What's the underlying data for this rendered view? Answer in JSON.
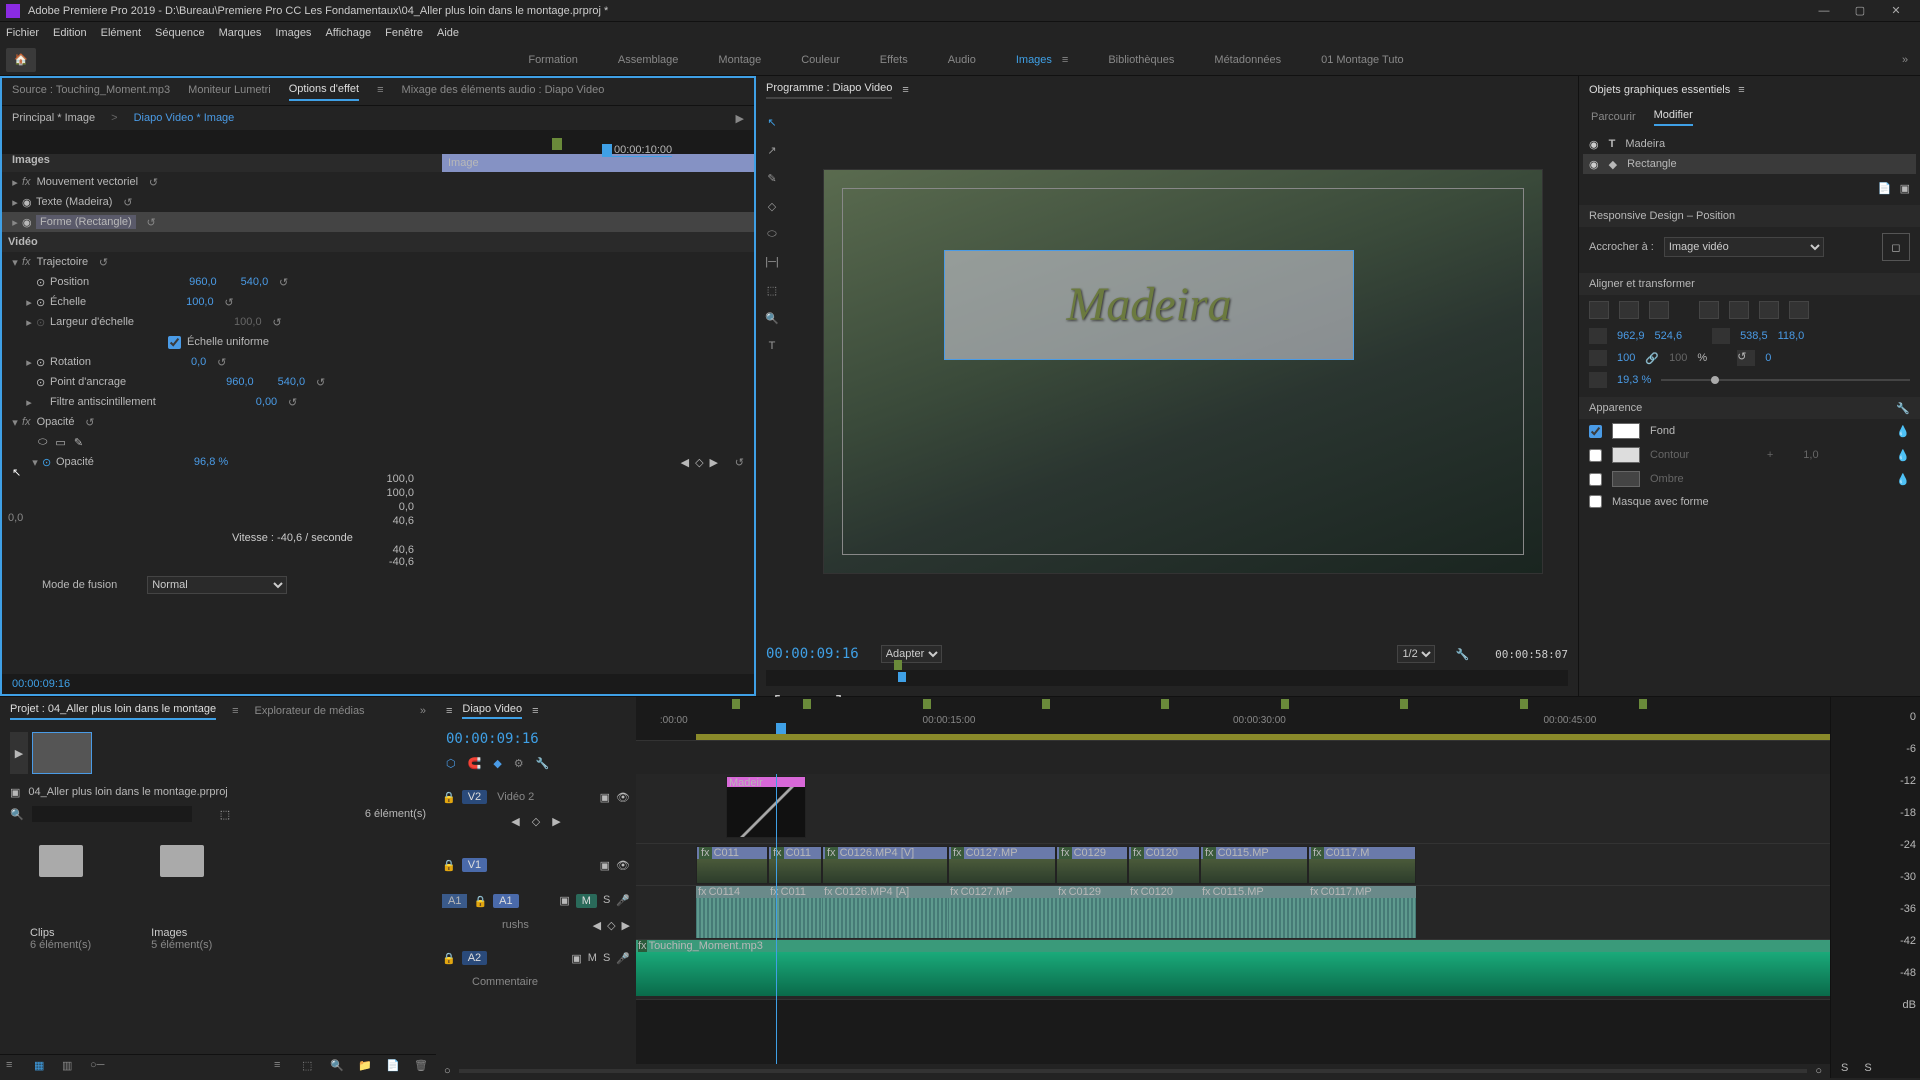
{
  "titlebar": {
    "app": "Adobe Premiere Pro 2019 - D:\\Bureau\\Premiere Pro CC Les Fondamentaux\\04_Aller plus loin dans le montage.prproj *"
  },
  "menu": [
    "Fichier",
    "Edition",
    "Elément",
    "Séquence",
    "Marques",
    "Images",
    "Affichage",
    "Fenêtre",
    "Aide"
  ],
  "workspaces": [
    "Formation",
    "Assemblage",
    "Montage",
    "Couleur",
    "Effets",
    "Audio",
    "Images",
    "Bibliothèques",
    "Métadonnées",
    "01 Montage Tuto"
  ],
  "workspace_active": "Images",
  "source_tabs": {
    "source": "Source : Touching_Moment.mp3",
    "lumetri": "Moniteur Lumetri",
    "effects": "Options d'effet",
    "audio_mix": "Mixage des éléments audio : Diapo Video"
  },
  "effect": {
    "master": "Principal * Image",
    "seq": "Diapo Video * Image",
    "timecode": "00:00:10:00",
    "clip_label": "Image",
    "section_images": "Images",
    "rows": {
      "motion_vec": "Mouvement vectoriel",
      "text": "Texte (Madeira)",
      "shape": "Forme (Rectangle)"
    },
    "section_video": "Vidéo",
    "traj": "Trajectoire",
    "position": {
      "label": "Position",
      "x": "960,0",
      "y": "540,0"
    },
    "scale": {
      "label": "Échelle",
      "v": "100,0"
    },
    "scale_w": {
      "label": "Largeur d'échelle",
      "v": "100,0"
    },
    "uniform": "Échelle uniforme",
    "rotation": {
      "label": "Rotation",
      "v": "0,0"
    },
    "anchor": {
      "label": "Point d'ancrage",
      "x": "960,0",
      "y": "540,0"
    },
    "flicker": {
      "label": "Filtre antiscintillement",
      "v": "0,00"
    },
    "opacity_section": "Opacité",
    "opacity": {
      "label": "Opacité",
      "v": "96,8 %"
    },
    "graph": {
      "max": "100,0",
      "mid": "100,0",
      "zero": "0,0",
      "v1": "40,6",
      "v2": "40,6",
      "v3": "-40,6"
    },
    "velocity": "Vitesse : -40,6 / seconde",
    "blend": {
      "label": "Mode de fusion",
      "value": "Normal"
    },
    "footer_tc": "00:00:09:16",
    "graph_zero": "0,0"
  },
  "program": {
    "tab": "Programme : Diapo Video",
    "title_text": "Madeira",
    "tc": "00:00:09:16",
    "fit": "Adapter",
    "zoom": "1/2",
    "dur": "00:00:58:07"
  },
  "egp": {
    "title": "Objets graphiques essentiels",
    "browse": "Parcourir",
    "edit": "Modifier",
    "layers": [
      {
        "icon": "T",
        "name": "Madeira"
      },
      {
        "icon": "◆",
        "name": "Rectangle"
      }
    ],
    "responsive": "Responsive Design – Position",
    "pin_to": "Accrocher à :",
    "pin_target": "Image vidéo",
    "align": "Aligner et transformer",
    "pos": {
      "x": "962,9",
      "y": "524,6",
      "ax": "538,5",
      "ay": "118,0"
    },
    "scale": "100",
    "scale2": "100",
    "pct": "%",
    "rot": "0",
    "opacity": "19,3 %",
    "appearance": "Apparence",
    "fill": "Fond",
    "stroke": "Contour",
    "stroke_w": "1,0",
    "shadow": "Ombre",
    "mask": "Masque avec forme"
  },
  "project": {
    "tab": "Projet : 04_Aller plus loin dans le montage",
    "explorer": "Explorateur de médias",
    "filename": "04_Aller plus loin dans le montage.prproj",
    "count": "6 élément(s)",
    "bins": [
      {
        "name": "Clips",
        "count": "6 élément(s)"
      },
      {
        "name": "Images",
        "count": "5 élément(s)"
      }
    ]
  },
  "timeline": {
    "name": "Diapo Video",
    "tc": "00:00:09:16",
    "ruler": [
      ":00:00",
      "00:00:15:00",
      "00:00:30:00",
      "00:00:45:00"
    ],
    "v2": {
      "label": "V2",
      "name": "Vidéo 2",
      "clip": "Madeir"
    },
    "v1": {
      "label": "V1",
      "clips": [
        "C011",
        "C011",
        "C0126.MP4 [V]",
        "C0127.MP",
        "C0129",
        "C0120",
        "C0115.MP",
        "C0117.M"
      ]
    },
    "a1": {
      "label": "A1",
      "src": "A1",
      "name": "rushs",
      "clips": [
        "C0114",
        "C011",
        "C0126.MP4 [A]",
        "C0127.MP",
        "C0129",
        "C0120",
        "C0115.MP",
        "C0117.MP"
      ]
    },
    "a2": {
      "label": "A2",
      "name": "Commentaire",
      "clip": "Touching_Moment.mp3"
    },
    "mute": "M",
    "solo": "S"
  },
  "meter_scale": [
    "0",
    "-6",
    "-12",
    "-18",
    "-24",
    "-30",
    "-36",
    "-42",
    "-48",
    "dB"
  ]
}
